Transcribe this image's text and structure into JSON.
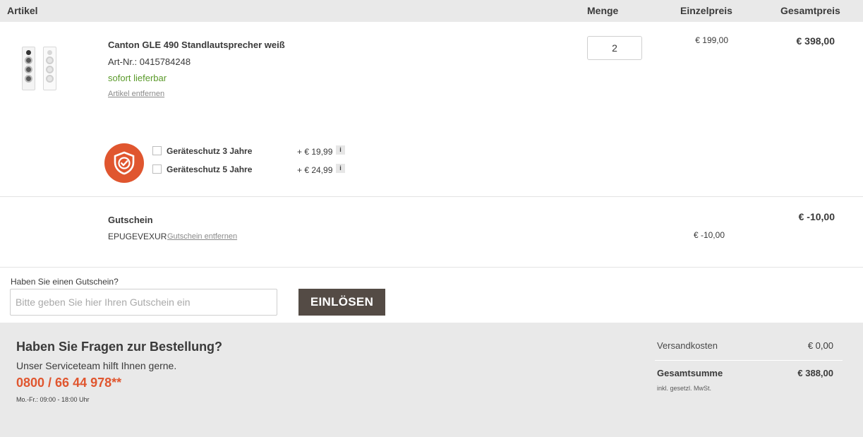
{
  "header": {
    "artikel": "Artikel",
    "menge": "Menge",
    "einzelpreis": "Einzelpreis",
    "gesamtpreis": "Gesamtpreis"
  },
  "product": {
    "name": "Canton GLE 490 Standlautsprecher weiß",
    "art_nr": "Art-Nr.: 0415784248",
    "availability": "sofort lieferbar",
    "remove_label": "Artikel entfernen",
    "quantity": "2",
    "unit_price": "€ 199,00",
    "total_price": "€ 398,00",
    "image_icon": "speaker-pair-icon"
  },
  "protection": {
    "icon": "shield-check-icon",
    "options": [
      {
        "label": "Geräteschutz 3 Jahre",
        "price": "+ € 19,99",
        "info": "i",
        "checked": false
      },
      {
        "label": "Geräteschutz 5 Jahre",
        "price": "+ € 24,99",
        "info": "i",
        "checked": false
      }
    ]
  },
  "voucher": {
    "title": "Gutschein",
    "code": "EPUGEVEXUR",
    "remove_label": "Gutschein entfernen",
    "unit_price": "€ -10,00",
    "total_price": "€ -10,00"
  },
  "coupon_form": {
    "label": "Haben Sie einen Gutschein?",
    "placeholder": "Bitte geben Sie hier Ihren Gutschein ein",
    "button_label": "EINLÖSEN"
  },
  "footer": {
    "title": "Haben Sie Fragen zur Bestellung?",
    "subtitle": "Unser Serviceteam hilft Ihnen gerne.",
    "phone": "0800 / 66 44 978**",
    "hours": "Mo.-Fr.: 09:00 - 18:00 Uhr",
    "shipping_label": "Versandkosten",
    "shipping_value": "€ 0,00",
    "sum_label": "Gesamtsumme",
    "sum_value": "€ 388,00",
    "vat_note": "inkl. gesetzl. MwSt."
  },
  "colors": {
    "accent": "#e0562f",
    "in_stock": "#5a9a2a",
    "button": "#544b45",
    "header_bg": "#e9e9e9"
  }
}
